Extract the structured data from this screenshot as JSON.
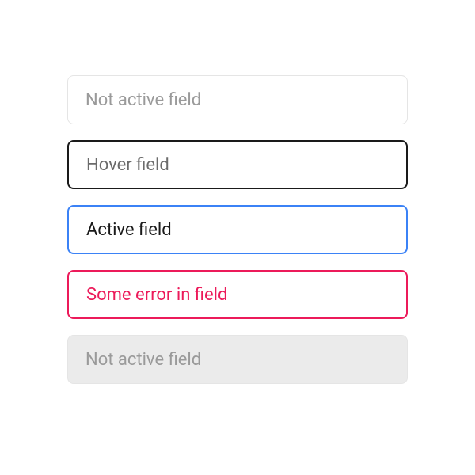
{
  "fields": {
    "inactive": {
      "label": "Not active field"
    },
    "hover": {
      "label": "Hover field"
    },
    "active": {
      "label": "Active field"
    },
    "error": {
      "label": "Some error in field"
    },
    "disabled": {
      "label": "Not active field"
    }
  },
  "colors": {
    "border_default": "#e5e5e5",
    "border_hover": "#1a1a1a",
    "border_active": "#3b82f6",
    "border_error": "#ec1a5a",
    "bg_disabled": "#ebebeb",
    "text_placeholder": "#9a9a9a",
    "text_active": "#1a1a1a",
    "text_error": "#ec1a5a"
  }
}
